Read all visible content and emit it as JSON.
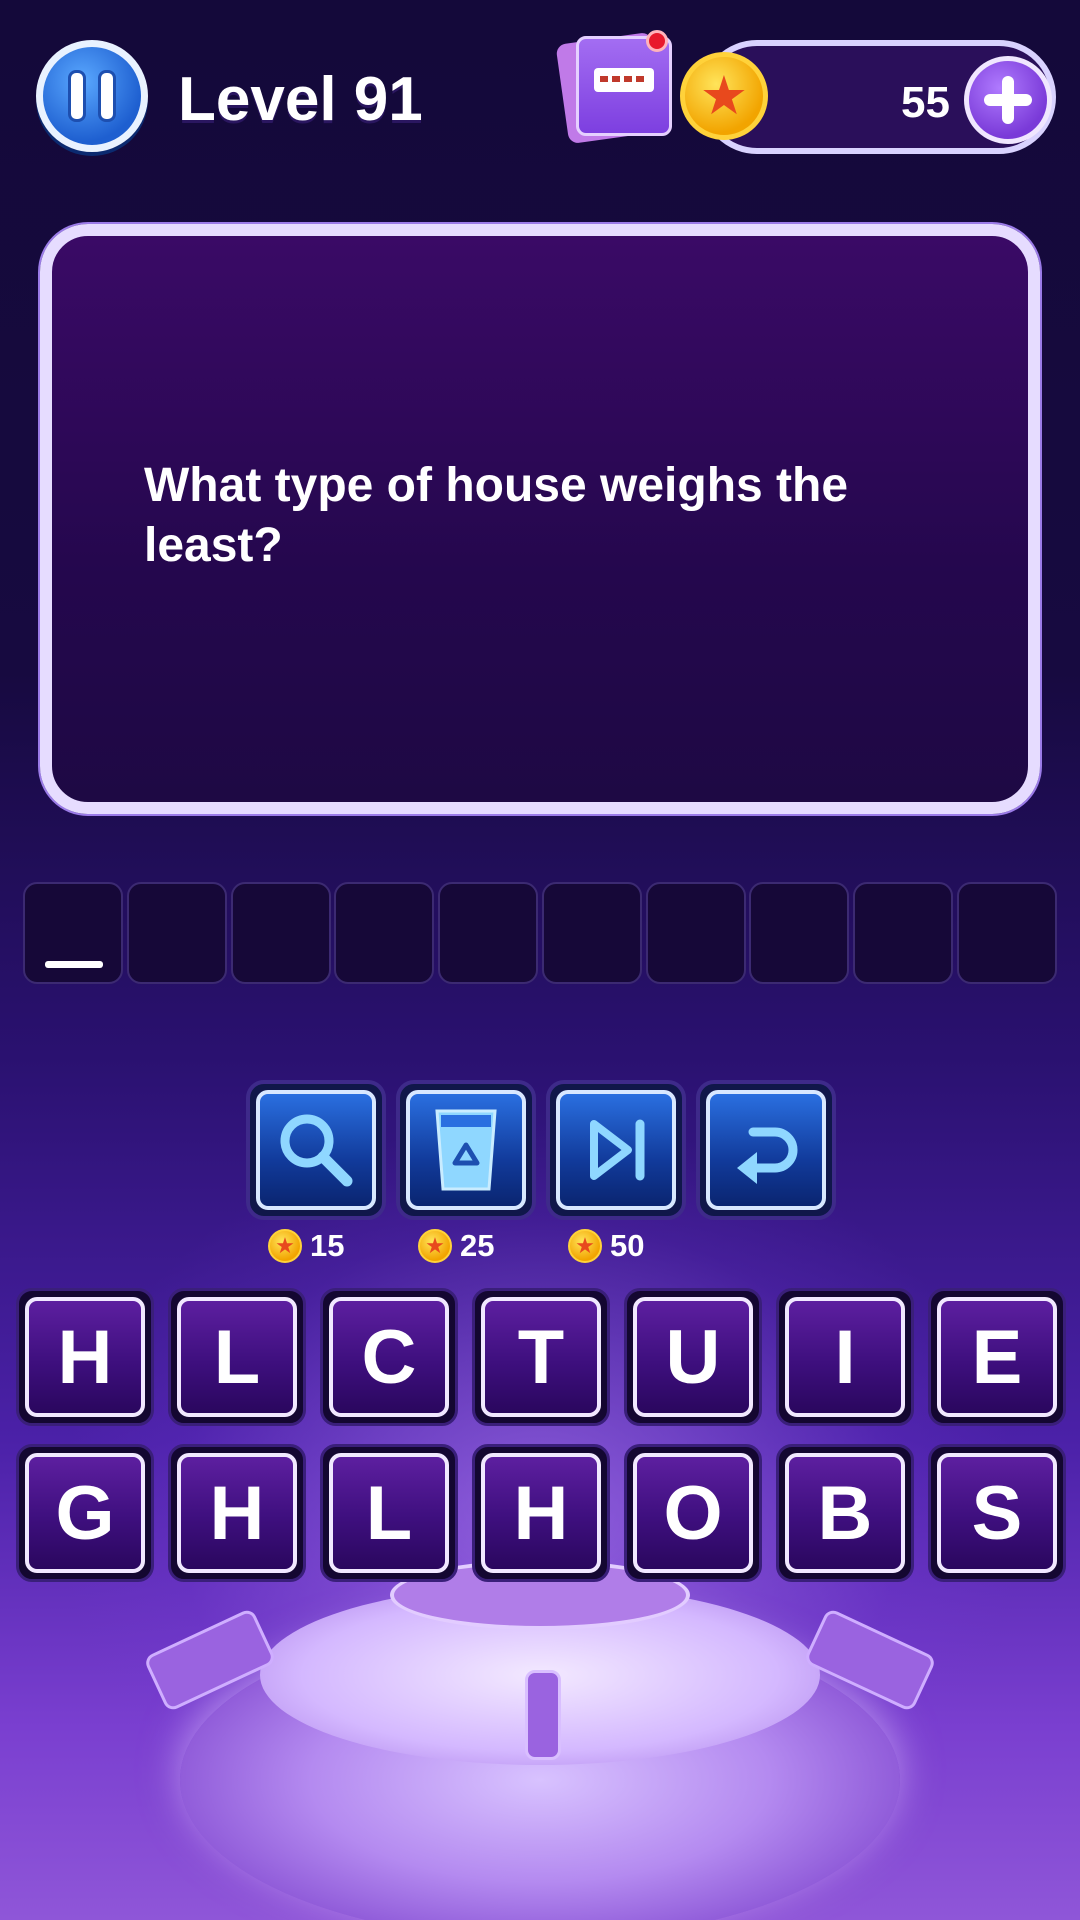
{
  "header": {
    "level_title": "Level 91",
    "coins": "55",
    "pause_icon": "pause-icon",
    "book_icon": "hint-book-icon",
    "coin_icon": "coin-star-icon",
    "add_icon": "plus-icon"
  },
  "question": {
    "text": "What type of house weighs the least?"
  },
  "answer": {
    "slot_count": 10,
    "filled": [
      "",
      "",
      "",
      "",
      "",
      "",
      "",
      "",
      "",
      ""
    ]
  },
  "tools": [
    {
      "name": "magnifier",
      "icon": "search-icon",
      "cost": "15"
    },
    {
      "name": "remove-letters",
      "icon": "recycle-bin-icon",
      "cost": "25"
    },
    {
      "name": "skip",
      "icon": "skip-icon",
      "cost": "50"
    },
    {
      "name": "undo",
      "icon": "undo-icon",
      "cost": ""
    }
  ],
  "letters": {
    "row1": [
      "H",
      "L",
      "C",
      "T",
      "U",
      "I",
      "E"
    ],
    "row2": [
      "G",
      "H",
      "L",
      "H",
      "O",
      "B",
      "S"
    ]
  },
  "colors": {
    "tile_purple": "#3e0f7e",
    "tool_blue": "#1d4fb0",
    "coin_gold": "#f2a400",
    "card_bg": "#24074d"
  }
}
